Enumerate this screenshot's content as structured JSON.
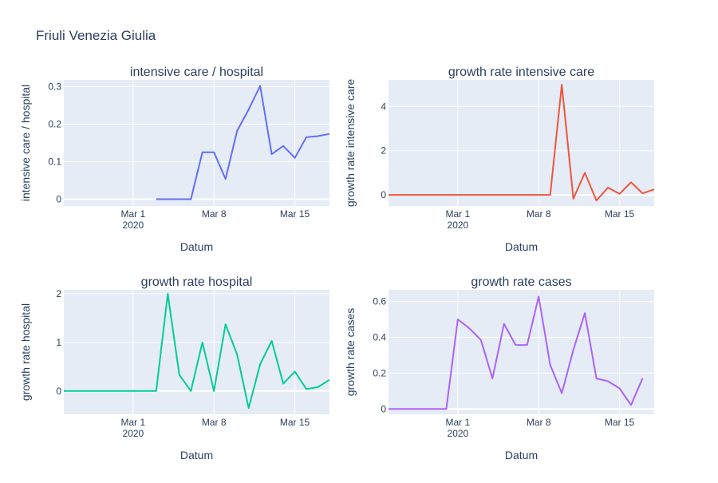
{
  "title": "Friuli Venezia Giulia",
  "chart_data": [
    {
      "type": "line",
      "title": "intensive care / hospital",
      "xlabel": "Datum",
      "ylabel": "intensive care / hospital",
      "color": "#636efa",
      "x_ticks": [
        "Mar 1",
        "Mar 8",
        "Mar 15"
      ],
      "x_year": "2020",
      "y_ticks": [
        "0",
        "0.1",
        "0.2",
        "0.3"
      ],
      "y_tick_values": [
        0,
        0.1,
        0.2,
        0.3
      ],
      "xlim": [
        "2020-02-24",
        "2020-03-18"
      ],
      "ylim": [
        -0.018,
        0.318
      ],
      "x": [
        "2020-03-03",
        "2020-03-04",
        "2020-03-05",
        "2020-03-06",
        "2020-03-07",
        "2020-03-08",
        "2020-03-09",
        "2020-03-10",
        "2020-03-11",
        "2020-03-12",
        "2020-03-13",
        "2020-03-14",
        "2020-03-15",
        "2020-03-16",
        "2020-03-17",
        "2020-03-18"
      ],
      "y": [
        0,
        0,
        0,
        0,
        0.125,
        0.125,
        0.054,
        0.182,
        0.239,
        0.302,
        0.12,
        0.142,
        0.11,
        0.165,
        0.168,
        0.174
      ]
    },
    {
      "type": "line",
      "title": "growth rate intensive care",
      "xlabel": "Datum",
      "ylabel": "growth rate intensive care",
      "color": "#ef553b",
      "x_ticks": [
        "Mar 1",
        "Mar 8",
        "Mar 15"
      ],
      "x_year": "2020",
      "y_ticks": [
        "0",
        "2",
        "4"
      ],
      "y_tick_values": [
        0,
        2,
        4
      ],
      "xlim": [
        "2020-02-24",
        "2020-03-18"
      ],
      "ylim": [
        -0.5,
        5.2
      ],
      "x": [
        "2020-02-24",
        "2020-02-25",
        "2020-02-26",
        "2020-02-27",
        "2020-02-28",
        "2020-02-29",
        "2020-03-01",
        "2020-03-02",
        "2020-03-03",
        "2020-03-04",
        "2020-03-05",
        "2020-03-06",
        "2020-03-07",
        "2020-03-08",
        "2020-03-09",
        "2020-03-10",
        "2020-03-11",
        "2020-03-12",
        "2020-03-13",
        "2020-03-14",
        "2020-03-15",
        "2020-03-16",
        "2020-03-17",
        "2020-03-18"
      ],
      "y": [
        0,
        0,
        0,
        0,
        0,
        0,
        0,
        0,
        0,
        0,
        0,
        0,
        0,
        0,
        0,
        4.98,
        -0.17,
        1.0,
        -0.25,
        0.33,
        0.05,
        0.57,
        0.07,
        0.25
      ]
    },
    {
      "type": "line",
      "title": "growth rate hospital",
      "xlabel": "Datum",
      "ylabel": "growth rate hospital",
      "color": "#00cc96",
      "x_ticks": [
        "Mar 1",
        "Mar 8",
        "Mar 15"
      ],
      "x_year": "2020",
      "y_ticks": [
        "0",
        "1",
        "2"
      ],
      "y_tick_values": [
        0,
        1,
        2
      ],
      "xlim": [
        "2020-02-24",
        "2020-03-18"
      ],
      "ylim": [
        -0.48,
        2.08
      ],
      "x": [
        "2020-02-24",
        "2020-02-25",
        "2020-02-26",
        "2020-02-27",
        "2020-02-28",
        "2020-02-29",
        "2020-03-01",
        "2020-03-02",
        "2020-03-03",
        "2020-03-04",
        "2020-03-05",
        "2020-03-06",
        "2020-03-07",
        "2020-03-08",
        "2020-03-09",
        "2020-03-10",
        "2020-03-11",
        "2020-03-12",
        "2020-03-13",
        "2020-03-14",
        "2020-03-15",
        "2020-03-16",
        "2020-03-17",
        "2020-03-18"
      ],
      "y": [
        0,
        0,
        0,
        0,
        0,
        0,
        0,
        0,
        0,
        2.0,
        0.33,
        0,
        1.0,
        0,
        1.37,
        0.75,
        -0.35,
        0.55,
        1.03,
        0.15,
        0.4,
        0.04,
        0.08,
        0.23
      ]
    },
    {
      "type": "line",
      "title": "growth rate cases",
      "xlabel": "Datum",
      "ylabel": "growth rate cases",
      "color": "#ab63fa",
      "x_ticks": [
        "Mar 1",
        "Mar 8",
        "Mar 15"
      ],
      "x_year": "2020",
      "y_ticks": [
        "0",
        "0.2",
        "0.4",
        "0.6"
      ],
      "y_tick_values": [
        0,
        0.2,
        0.4,
        0.6
      ],
      "xlim": [
        "2020-02-24",
        "2020-03-18"
      ],
      "ylim": [
        -0.03,
        0.665
      ],
      "x": [
        "2020-02-24",
        "2020-02-25",
        "2020-02-26",
        "2020-02-27",
        "2020-02-28",
        "2020-02-29",
        "2020-03-01",
        "2020-03-02",
        "2020-03-03",
        "2020-03-04",
        "2020-03-05",
        "2020-03-06",
        "2020-03-07",
        "2020-03-08",
        "2020-03-09",
        "2020-03-10",
        "2020-03-11",
        "2020-03-12",
        "2020-03-13",
        "2020-03-14",
        "2020-03-15",
        "2020-03-16",
        "2020-03-17",
        "2020-03-18"
      ],
      "y": [
        0,
        0,
        0,
        0,
        0,
        0,
        0.5,
        0.45,
        0.385,
        0.17,
        0.475,
        0.357,
        0.357,
        0.627,
        0.245,
        0.088,
        0.33,
        0.535,
        0.17,
        0.155,
        0.115,
        0.022,
        0.172
      ]
    }
  ]
}
